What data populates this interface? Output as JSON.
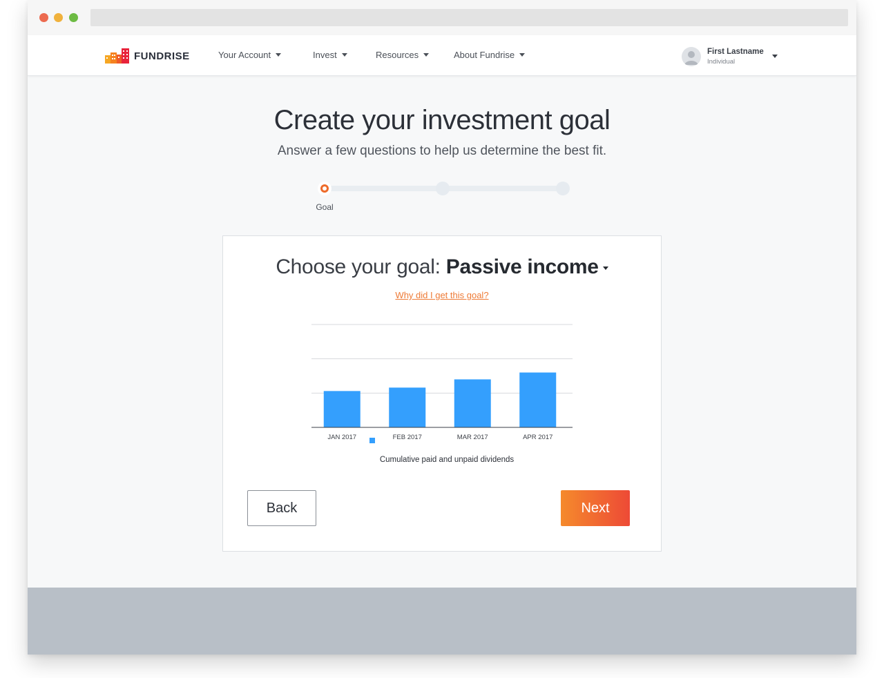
{
  "brand": {
    "name": "FUNDRISE"
  },
  "nav": {
    "items": [
      {
        "label": "Your Account"
      },
      {
        "label": "Invest"
      },
      {
        "label": "Resources"
      },
      {
        "label": "About Fundrise"
      }
    ],
    "user": {
      "name": "First Lastname",
      "account_type": "Individual"
    }
  },
  "page": {
    "title": "Create your investment goal",
    "subtitle": "Answer a few questions to help us determine the best fit."
  },
  "stepper": {
    "steps": [
      {
        "label": "Goal",
        "active": true
      },
      {
        "label": "",
        "active": false
      },
      {
        "label": "",
        "active": false
      }
    ]
  },
  "goal": {
    "prompt": "Choose your goal: ",
    "value": "Passive income",
    "why_link": "Why did I get this goal?"
  },
  "chart_data": {
    "type": "bar",
    "categories": [
      "JAN 2017",
      "FEB 2017",
      "MAR 2017",
      "APR 2017"
    ],
    "values": [
      53,
      58,
      70,
      80
    ],
    "ylim": [
      0,
      150
    ],
    "grid": true,
    "legend": {
      "label": "Cumulative paid and unpaid dividends",
      "placement": "bottom",
      "color": "#349ffd"
    },
    "title": "",
    "xlabel": "",
    "ylabel": ""
  },
  "buttons": {
    "back": "Back",
    "next": "Next"
  },
  "colors": {
    "accent": "#ee6b2b",
    "bar": "#349ffd",
    "link": "#ee7a35"
  }
}
